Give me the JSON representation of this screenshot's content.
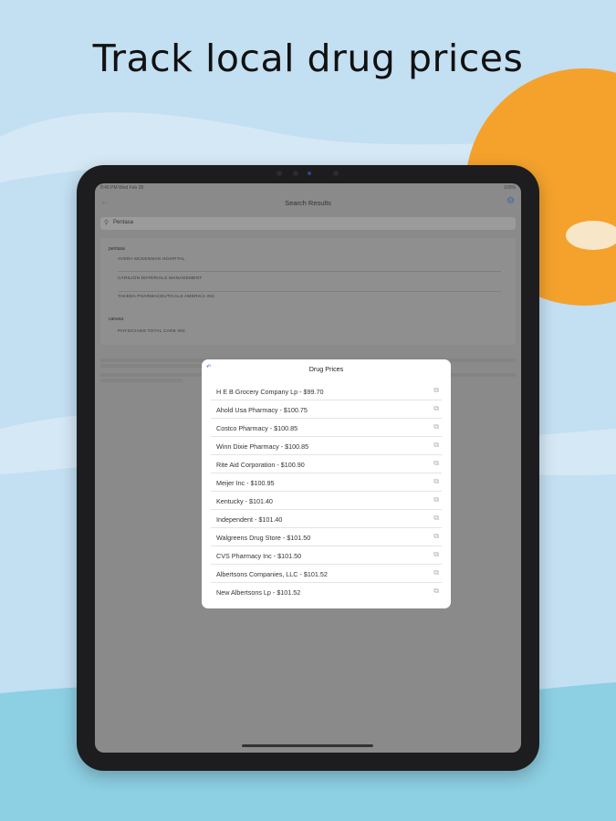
{
  "headline": "Track local drug prices",
  "colors": {
    "sky": "#c3dff2",
    "sun": "#f4a22c",
    "water": "#8dcfe3",
    "link": "#3a78c8"
  },
  "status_bar": {
    "left": "8:46 PM  Wed Feb 28",
    "right": "100%"
  },
  "nav": {
    "back_icon": "chevron-left",
    "title": "Search Results",
    "settings_icon": "gear"
  },
  "search": {
    "icon": "search",
    "value": "Pentasa"
  },
  "results": {
    "sections": [
      {
        "header": "pentasa",
        "items": [
          "AVERA MCKENNAN HOSPITAL",
          "CARILION MATERIALS MANAGEMENT",
          "TAKEDA PHARMACEUTICALS AMERICA INC"
        ]
      },
      {
        "header": "canasa",
        "items": [
          "PHYSICIANS TOTAL CARE INC"
        ]
      }
    ]
  },
  "modal": {
    "back_label": "↶",
    "title": "Drug Prices",
    "prices": [
      "H E B Grocery Company Lp - $99.70",
      "Ahold Usa Pharmacy - $100.75",
      "Costco Pharmacy - $100.85",
      "Winn Dixie Pharmacy - $100.85",
      "Rite Aid Corporation - $100.90",
      "Meijer Inc - $100.95",
      "Kentucky - $101.40",
      "Independent - $101.40",
      "Walgreens Drug Store - $101.50",
      "CVS Pharmacy Inc - $101.50",
      "Albertsons Companies, LLC - $101.52",
      "New Albertsons Lp - $101.52"
    ],
    "link_icon": "external-link"
  }
}
